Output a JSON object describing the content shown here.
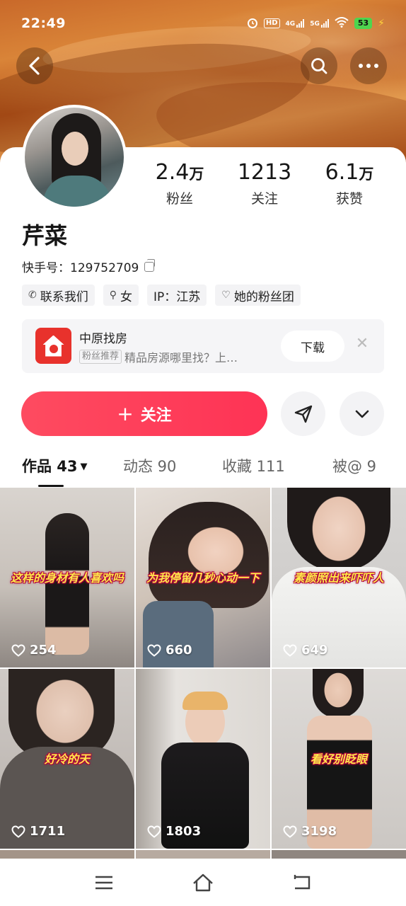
{
  "status_bar": {
    "time": "22:49",
    "icons": [
      "alarm-icon",
      "hd-icon",
      "4g-signal-icon",
      "5g-signal-icon",
      "wifi-icon"
    ],
    "hd_label": "HD",
    "net1": "4G",
    "net2": "5G",
    "battery": "53"
  },
  "header": {
    "back_icon": "chevron-left-icon",
    "search_icon": "search-icon",
    "more_icon": "more-horizontal-icon"
  },
  "profile": {
    "stats": [
      {
        "value": "2.4",
        "unit": "万",
        "label": "粉丝"
      },
      {
        "value": "1213",
        "unit": "",
        "label": "关注"
      },
      {
        "value": "6.1",
        "unit": "万",
        "label": "获赞"
      }
    ],
    "name": "芹菜",
    "account_label": "快手号：",
    "account_id": "129752709",
    "tags": [
      {
        "icon": "phone-icon",
        "glyph": "✆",
        "label": "联系我们"
      },
      {
        "icon": "female-icon",
        "glyph": "⚲",
        "label": "女"
      },
      {
        "icon": "",
        "glyph": "",
        "label": "IP：江苏"
      },
      {
        "icon": "heart-outline-icon",
        "glyph": "♡",
        "label": "她的粉丝团"
      }
    ]
  },
  "ad": {
    "title": "中原找房",
    "badge": "粉丝推荐",
    "subtitle": "精品房源哪里找？上…",
    "download_label": "下载",
    "close_glyph": "✕"
  },
  "actions": {
    "follow_label": "关注",
    "follow_plus": "+"
  },
  "tabs": [
    {
      "label": "作品 43",
      "active": true
    },
    {
      "label": "动态 90",
      "active": false
    },
    {
      "label": "收藏 111",
      "active": false
    },
    {
      "label": "被@ 9",
      "active": false
    }
  ],
  "videos": [
    {
      "caption": "这样的身材有人喜欢吗",
      "likes": "254"
    },
    {
      "caption": "为我停留几秒心动一下",
      "likes": "660"
    },
    {
      "caption": "素颜照出来吓吓人",
      "likes": "649"
    },
    {
      "caption": "好冷的天",
      "likes": "1711"
    },
    {
      "caption": "",
      "likes": "1803"
    },
    {
      "caption": "看好别眨眼",
      "likes": "3198"
    }
  ],
  "nav": {
    "menu_icon": "menu-icon",
    "home_icon": "home-icon",
    "back_icon": "back-icon"
  }
}
